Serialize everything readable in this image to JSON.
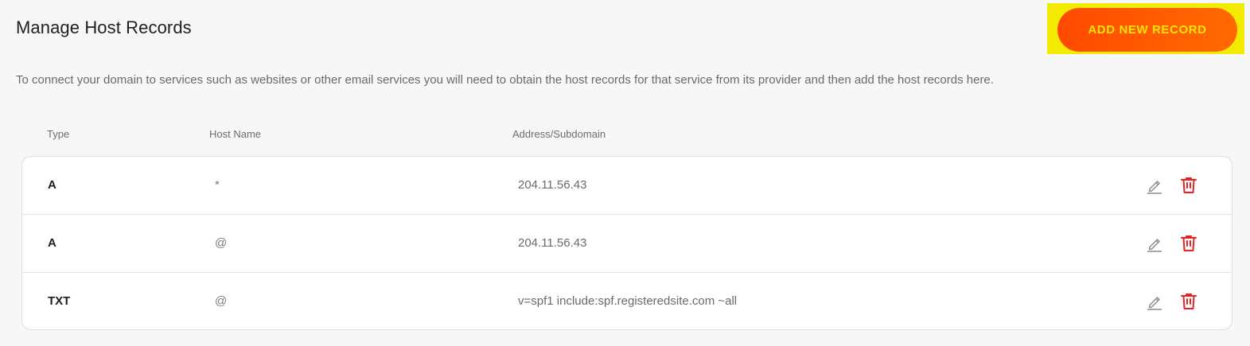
{
  "header": {
    "title": "Manage Host Records",
    "add_button_label": "ADD NEW RECORD"
  },
  "description": "To connect your domain to services such as websites or other email services you will need to obtain the host records for that service from its provider and then add the host records here.",
  "table": {
    "columns": {
      "type": "Type",
      "host": "Host Name",
      "address": "Address/Subdomain"
    },
    "rows": [
      {
        "type": "A",
        "host": "*",
        "address": "204.11.56.43"
      },
      {
        "type": "A",
        "host": "@",
        "address": "204.11.56.43"
      },
      {
        "type": "TXT",
        "host": "@",
        "address": "v=spf1 include:spf.registeredsite.com ~all"
      }
    ]
  },
  "icons": {
    "edit": "pencil-icon",
    "delete": "trash-icon"
  },
  "colors": {
    "accent": "#ff5500",
    "button_text": "#f6e500",
    "highlight": "#f2ea00",
    "delete": "#e8231f",
    "edit": "#8a8a8a"
  }
}
